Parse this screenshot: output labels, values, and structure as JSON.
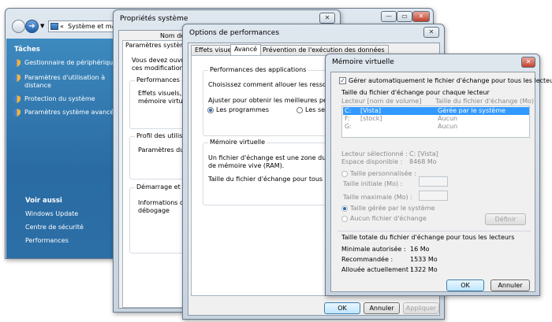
{
  "explorer": {
    "breadcrumb": "Système et mai",
    "tasks_title": "Tâches",
    "tasks": [
      "Gestionnaire de périphériques",
      "Paramètres d'utilisation à distance",
      "Protection du système",
      "Paramètres système avancés"
    ],
    "see_also_title": "Voir aussi",
    "see_also": [
      "Windows Update",
      "Centre de sécurité",
      "Performances"
    ]
  },
  "system_props": {
    "title": "Propriétés système",
    "tab_partial": "Nom de l",
    "tab_partial2": "Paramètres système a",
    "admin_note_1": "Vous devez ouvrir u",
    "admin_note_2": "ces modifications.",
    "perf_group": "Performances",
    "perf_text_1": "Effets visuels, plani",
    "perf_text_2": "mémoire virtuelle",
    "profiles_group": "Profil des utilisateur",
    "profiles_text": "Paramètres du Bure",
    "startup_group": "Démarrage et récup",
    "startup_text_1": "Informations de dér",
    "startup_text_2": "débogage"
  },
  "perf_options": {
    "title": "Options de performances",
    "tabs": [
      "Effets visuels",
      "Avancé",
      "Prévention de l'exécution des données"
    ],
    "apps_group": "Performances des applications",
    "apps_text": "Choisissez comment allouer les ressources du p",
    "adjust_text": "Ajuster pour obtenir les meilleures performance",
    "radio_programs": "Les programmes",
    "radio_services": "Les servi",
    "vm_group": "Mémoire virtuelle",
    "vm_text_1": "Un fichier d'échange est une zone du disque qu",
    "vm_text_2": "de mémoire vive (RAM).",
    "vm_total": "Taille du fichier d'échange pour tous les lecteurs",
    "ok": "OK",
    "cancel": "Annuler",
    "apply": "Appliquer"
  },
  "virtual_memory": {
    "title": "Mémoire virtuelle",
    "auto_manage": "Gérer automatiquement le fichier d'échange pour tous les lecteurs",
    "size_group": "Taille du fichier d'échange pour chaque lecteur",
    "col_drive": "Lecteur [nom de volume]",
    "col_size": "Taille du fichier d'échange (Mo)",
    "drives": [
      {
        "drive": "C:",
        "label": "[Vista]",
        "size": "Gérée par le système"
      },
      {
        "drive": "F:",
        "label": "[stock]",
        "size": "Aucun"
      },
      {
        "drive": "G:",
        "label": "",
        "size": "Aucun"
      }
    ],
    "selected_drive_label": "Lecteur sélectionné :",
    "selected_drive_value": "C:  [Vista]",
    "free_space_label": "Espace disponible :",
    "free_space_value": "8468 Mo",
    "custom_size": "Taille personnalisée :",
    "initial_size": "Taille initiale (Mo) :",
    "max_size": "Taille maximale (Mo) :",
    "system_managed": "Taille gérée par le système",
    "no_paging": "Aucun fichier d'échange",
    "set_button": "Définir",
    "total_group": "Taille totale du fichier d'échange pour tous les lecteurs",
    "min_label": "Minimale autorisée :",
    "min_value": "16 Mo",
    "rec_label": "Recommandée :",
    "rec_value": "1533 Mo",
    "alloc_label": "Allouée actuellement :",
    "alloc_value": "1322 Mo",
    "ok": "OK",
    "cancel": "Annuler"
  }
}
